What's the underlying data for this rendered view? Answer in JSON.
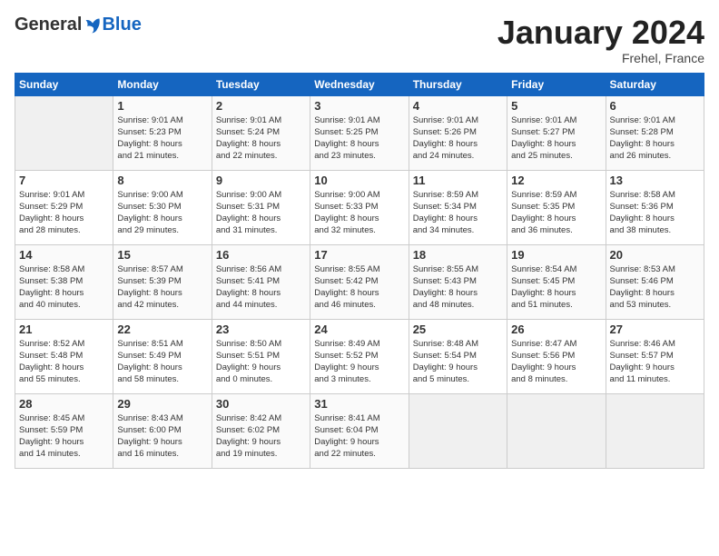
{
  "header": {
    "logo_general": "General",
    "logo_blue": "Blue",
    "month_title": "January 2024",
    "location": "Frehel, France"
  },
  "days_of_week": [
    "Sunday",
    "Monday",
    "Tuesday",
    "Wednesday",
    "Thursday",
    "Friday",
    "Saturday"
  ],
  "weeks": [
    [
      {
        "day": "",
        "info": ""
      },
      {
        "day": "1",
        "info": "Sunrise: 9:01 AM\nSunset: 5:23 PM\nDaylight: 8 hours\nand 21 minutes."
      },
      {
        "day": "2",
        "info": "Sunrise: 9:01 AM\nSunset: 5:24 PM\nDaylight: 8 hours\nand 22 minutes."
      },
      {
        "day": "3",
        "info": "Sunrise: 9:01 AM\nSunset: 5:25 PM\nDaylight: 8 hours\nand 23 minutes."
      },
      {
        "day": "4",
        "info": "Sunrise: 9:01 AM\nSunset: 5:26 PM\nDaylight: 8 hours\nand 24 minutes."
      },
      {
        "day": "5",
        "info": "Sunrise: 9:01 AM\nSunset: 5:27 PM\nDaylight: 8 hours\nand 25 minutes."
      },
      {
        "day": "6",
        "info": "Sunrise: 9:01 AM\nSunset: 5:28 PM\nDaylight: 8 hours\nand 26 minutes."
      }
    ],
    [
      {
        "day": "7",
        "info": "Sunrise: 9:01 AM\nSunset: 5:29 PM\nDaylight: 8 hours\nand 28 minutes."
      },
      {
        "day": "8",
        "info": "Sunrise: 9:00 AM\nSunset: 5:30 PM\nDaylight: 8 hours\nand 29 minutes."
      },
      {
        "day": "9",
        "info": "Sunrise: 9:00 AM\nSunset: 5:31 PM\nDaylight: 8 hours\nand 31 minutes."
      },
      {
        "day": "10",
        "info": "Sunrise: 9:00 AM\nSunset: 5:33 PM\nDaylight: 8 hours\nand 32 minutes."
      },
      {
        "day": "11",
        "info": "Sunrise: 8:59 AM\nSunset: 5:34 PM\nDaylight: 8 hours\nand 34 minutes."
      },
      {
        "day": "12",
        "info": "Sunrise: 8:59 AM\nSunset: 5:35 PM\nDaylight: 8 hours\nand 36 minutes."
      },
      {
        "day": "13",
        "info": "Sunrise: 8:58 AM\nSunset: 5:36 PM\nDaylight: 8 hours\nand 38 minutes."
      }
    ],
    [
      {
        "day": "14",
        "info": "Sunrise: 8:58 AM\nSunset: 5:38 PM\nDaylight: 8 hours\nand 40 minutes."
      },
      {
        "day": "15",
        "info": "Sunrise: 8:57 AM\nSunset: 5:39 PM\nDaylight: 8 hours\nand 42 minutes."
      },
      {
        "day": "16",
        "info": "Sunrise: 8:56 AM\nSunset: 5:41 PM\nDaylight: 8 hours\nand 44 minutes."
      },
      {
        "day": "17",
        "info": "Sunrise: 8:55 AM\nSunset: 5:42 PM\nDaylight: 8 hours\nand 46 minutes."
      },
      {
        "day": "18",
        "info": "Sunrise: 8:55 AM\nSunset: 5:43 PM\nDaylight: 8 hours\nand 48 minutes."
      },
      {
        "day": "19",
        "info": "Sunrise: 8:54 AM\nSunset: 5:45 PM\nDaylight: 8 hours\nand 51 minutes."
      },
      {
        "day": "20",
        "info": "Sunrise: 8:53 AM\nSunset: 5:46 PM\nDaylight: 8 hours\nand 53 minutes."
      }
    ],
    [
      {
        "day": "21",
        "info": "Sunrise: 8:52 AM\nSunset: 5:48 PM\nDaylight: 8 hours\nand 55 minutes."
      },
      {
        "day": "22",
        "info": "Sunrise: 8:51 AM\nSunset: 5:49 PM\nDaylight: 8 hours\nand 58 minutes."
      },
      {
        "day": "23",
        "info": "Sunrise: 8:50 AM\nSunset: 5:51 PM\nDaylight: 9 hours\nand 0 minutes."
      },
      {
        "day": "24",
        "info": "Sunrise: 8:49 AM\nSunset: 5:52 PM\nDaylight: 9 hours\nand 3 minutes."
      },
      {
        "day": "25",
        "info": "Sunrise: 8:48 AM\nSunset: 5:54 PM\nDaylight: 9 hours\nand 5 minutes."
      },
      {
        "day": "26",
        "info": "Sunrise: 8:47 AM\nSunset: 5:56 PM\nDaylight: 9 hours\nand 8 minutes."
      },
      {
        "day": "27",
        "info": "Sunrise: 8:46 AM\nSunset: 5:57 PM\nDaylight: 9 hours\nand 11 minutes."
      }
    ],
    [
      {
        "day": "28",
        "info": "Sunrise: 8:45 AM\nSunset: 5:59 PM\nDaylight: 9 hours\nand 14 minutes."
      },
      {
        "day": "29",
        "info": "Sunrise: 8:43 AM\nSunset: 6:00 PM\nDaylight: 9 hours\nand 16 minutes."
      },
      {
        "day": "30",
        "info": "Sunrise: 8:42 AM\nSunset: 6:02 PM\nDaylight: 9 hours\nand 19 minutes."
      },
      {
        "day": "31",
        "info": "Sunrise: 8:41 AM\nSunset: 6:04 PM\nDaylight: 9 hours\nand 22 minutes."
      },
      {
        "day": "",
        "info": ""
      },
      {
        "day": "",
        "info": ""
      },
      {
        "day": "",
        "info": ""
      }
    ]
  ]
}
